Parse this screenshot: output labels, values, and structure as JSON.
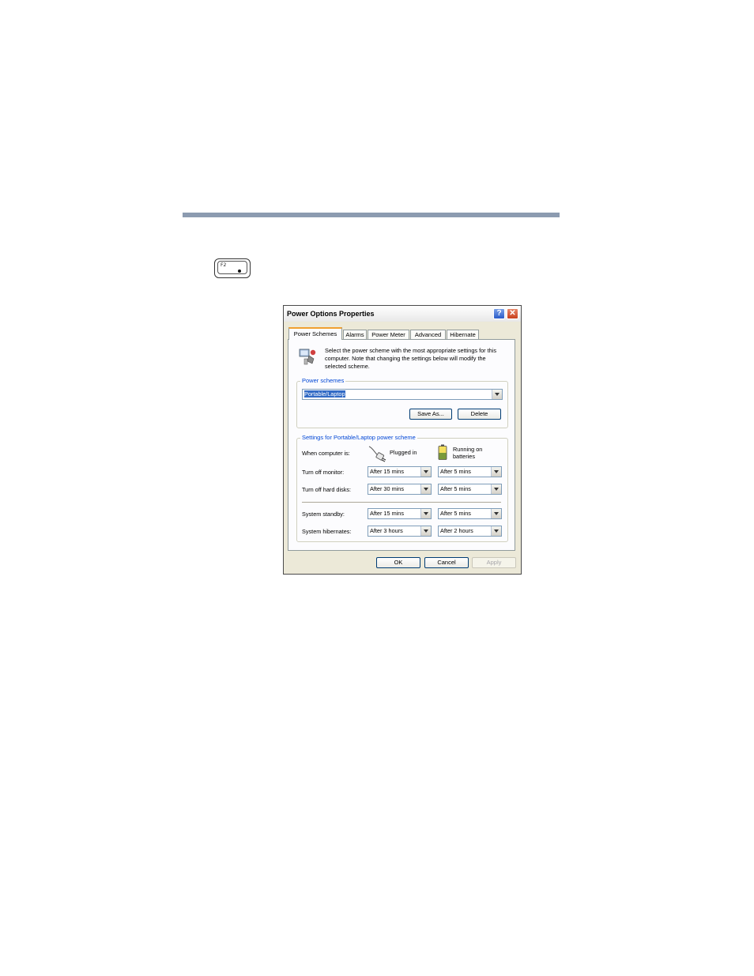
{
  "page": {
    "key_label": "F2"
  },
  "dialog": {
    "title": "Power Options Properties",
    "help_label": "?",
    "close_label": "✕",
    "tabs": [
      {
        "label": "Power Schemes"
      },
      {
        "label": "Alarms"
      },
      {
        "label": "Power Meter"
      },
      {
        "label": "Advanced"
      },
      {
        "label": "Hibernate"
      }
    ],
    "intro_text": "Select the power scheme with the most appropriate settings for this computer. Note that changing the settings below will modify the selected scheme.",
    "schemes": {
      "legend": "Power schemes",
      "selected": "Portable/Laptop",
      "save_as_label": "Save As...",
      "delete_label": "Delete"
    },
    "settings": {
      "legend": "Settings for Portable/Laptop power scheme",
      "when_label": "When computer is:",
      "plugged_label": "Plugged in",
      "battery_label_1": "Running on",
      "battery_label_2": "batteries",
      "rows": [
        {
          "label": "Turn off monitor:",
          "plugged": "After 15 mins",
          "battery": "After 5 mins"
        },
        {
          "label": "Turn off hard disks:",
          "plugged": "After 30 mins",
          "battery": "After 5 mins"
        },
        {
          "label": "System standby:",
          "plugged": "After 15 mins",
          "battery": "After 5 mins"
        },
        {
          "label": "System hibernates:",
          "plugged": "After 3 hours",
          "battery": "After 2 hours"
        }
      ]
    },
    "buttons": {
      "ok": "OK",
      "cancel": "Cancel",
      "apply": "Apply"
    }
  }
}
